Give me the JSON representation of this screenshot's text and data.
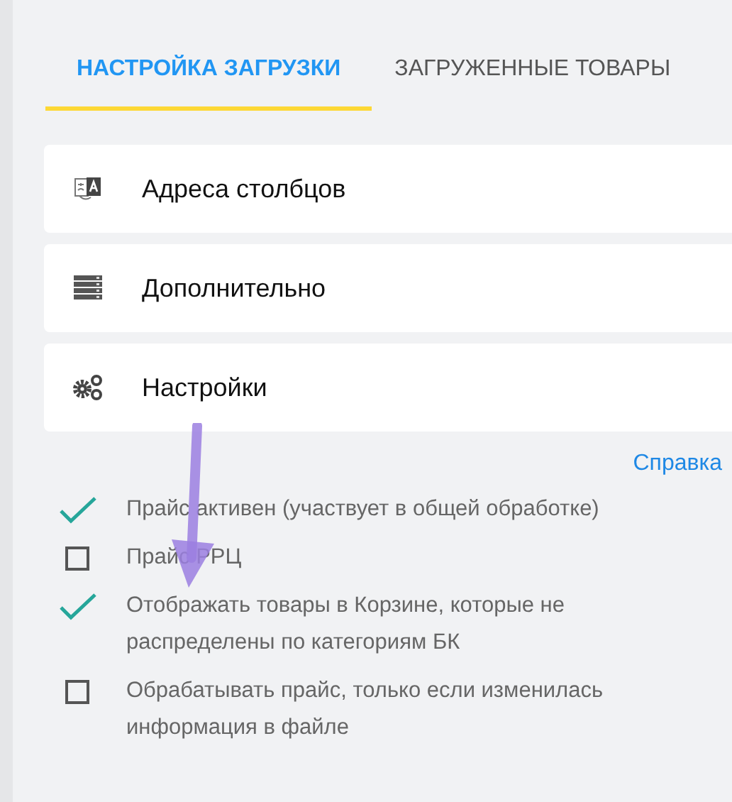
{
  "tabs": [
    {
      "label": "НАСТРОЙКА ЗАГРУЗКИ",
      "selected": true
    },
    {
      "label": "ЗАГРУЖЕННЫЕ ТОВАРЫ",
      "selected": false
    }
  ],
  "sections": [
    {
      "kind": "translate",
      "label": "Адреса столбцов"
    },
    {
      "kind": "server",
      "label": "Дополнительно"
    },
    {
      "kind": "gears",
      "label": "Настройки"
    }
  ],
  "help_link": "Справка",
  "options": [
    {
      "label": "Прайс активен (участвует в общей обработке)",
      "checked": true
    },
    {
      "label": "Прайс РРЦ",
      "checked": false
    },
    {
      "label": "Отображать товары в Корзине, которые не распределены по категориям БК",
      "checked": true
    },
    {
      "label": "Обрабатывать прайс, только если изменилась информация в файле",
      "checked": false
    }
  ]
}
